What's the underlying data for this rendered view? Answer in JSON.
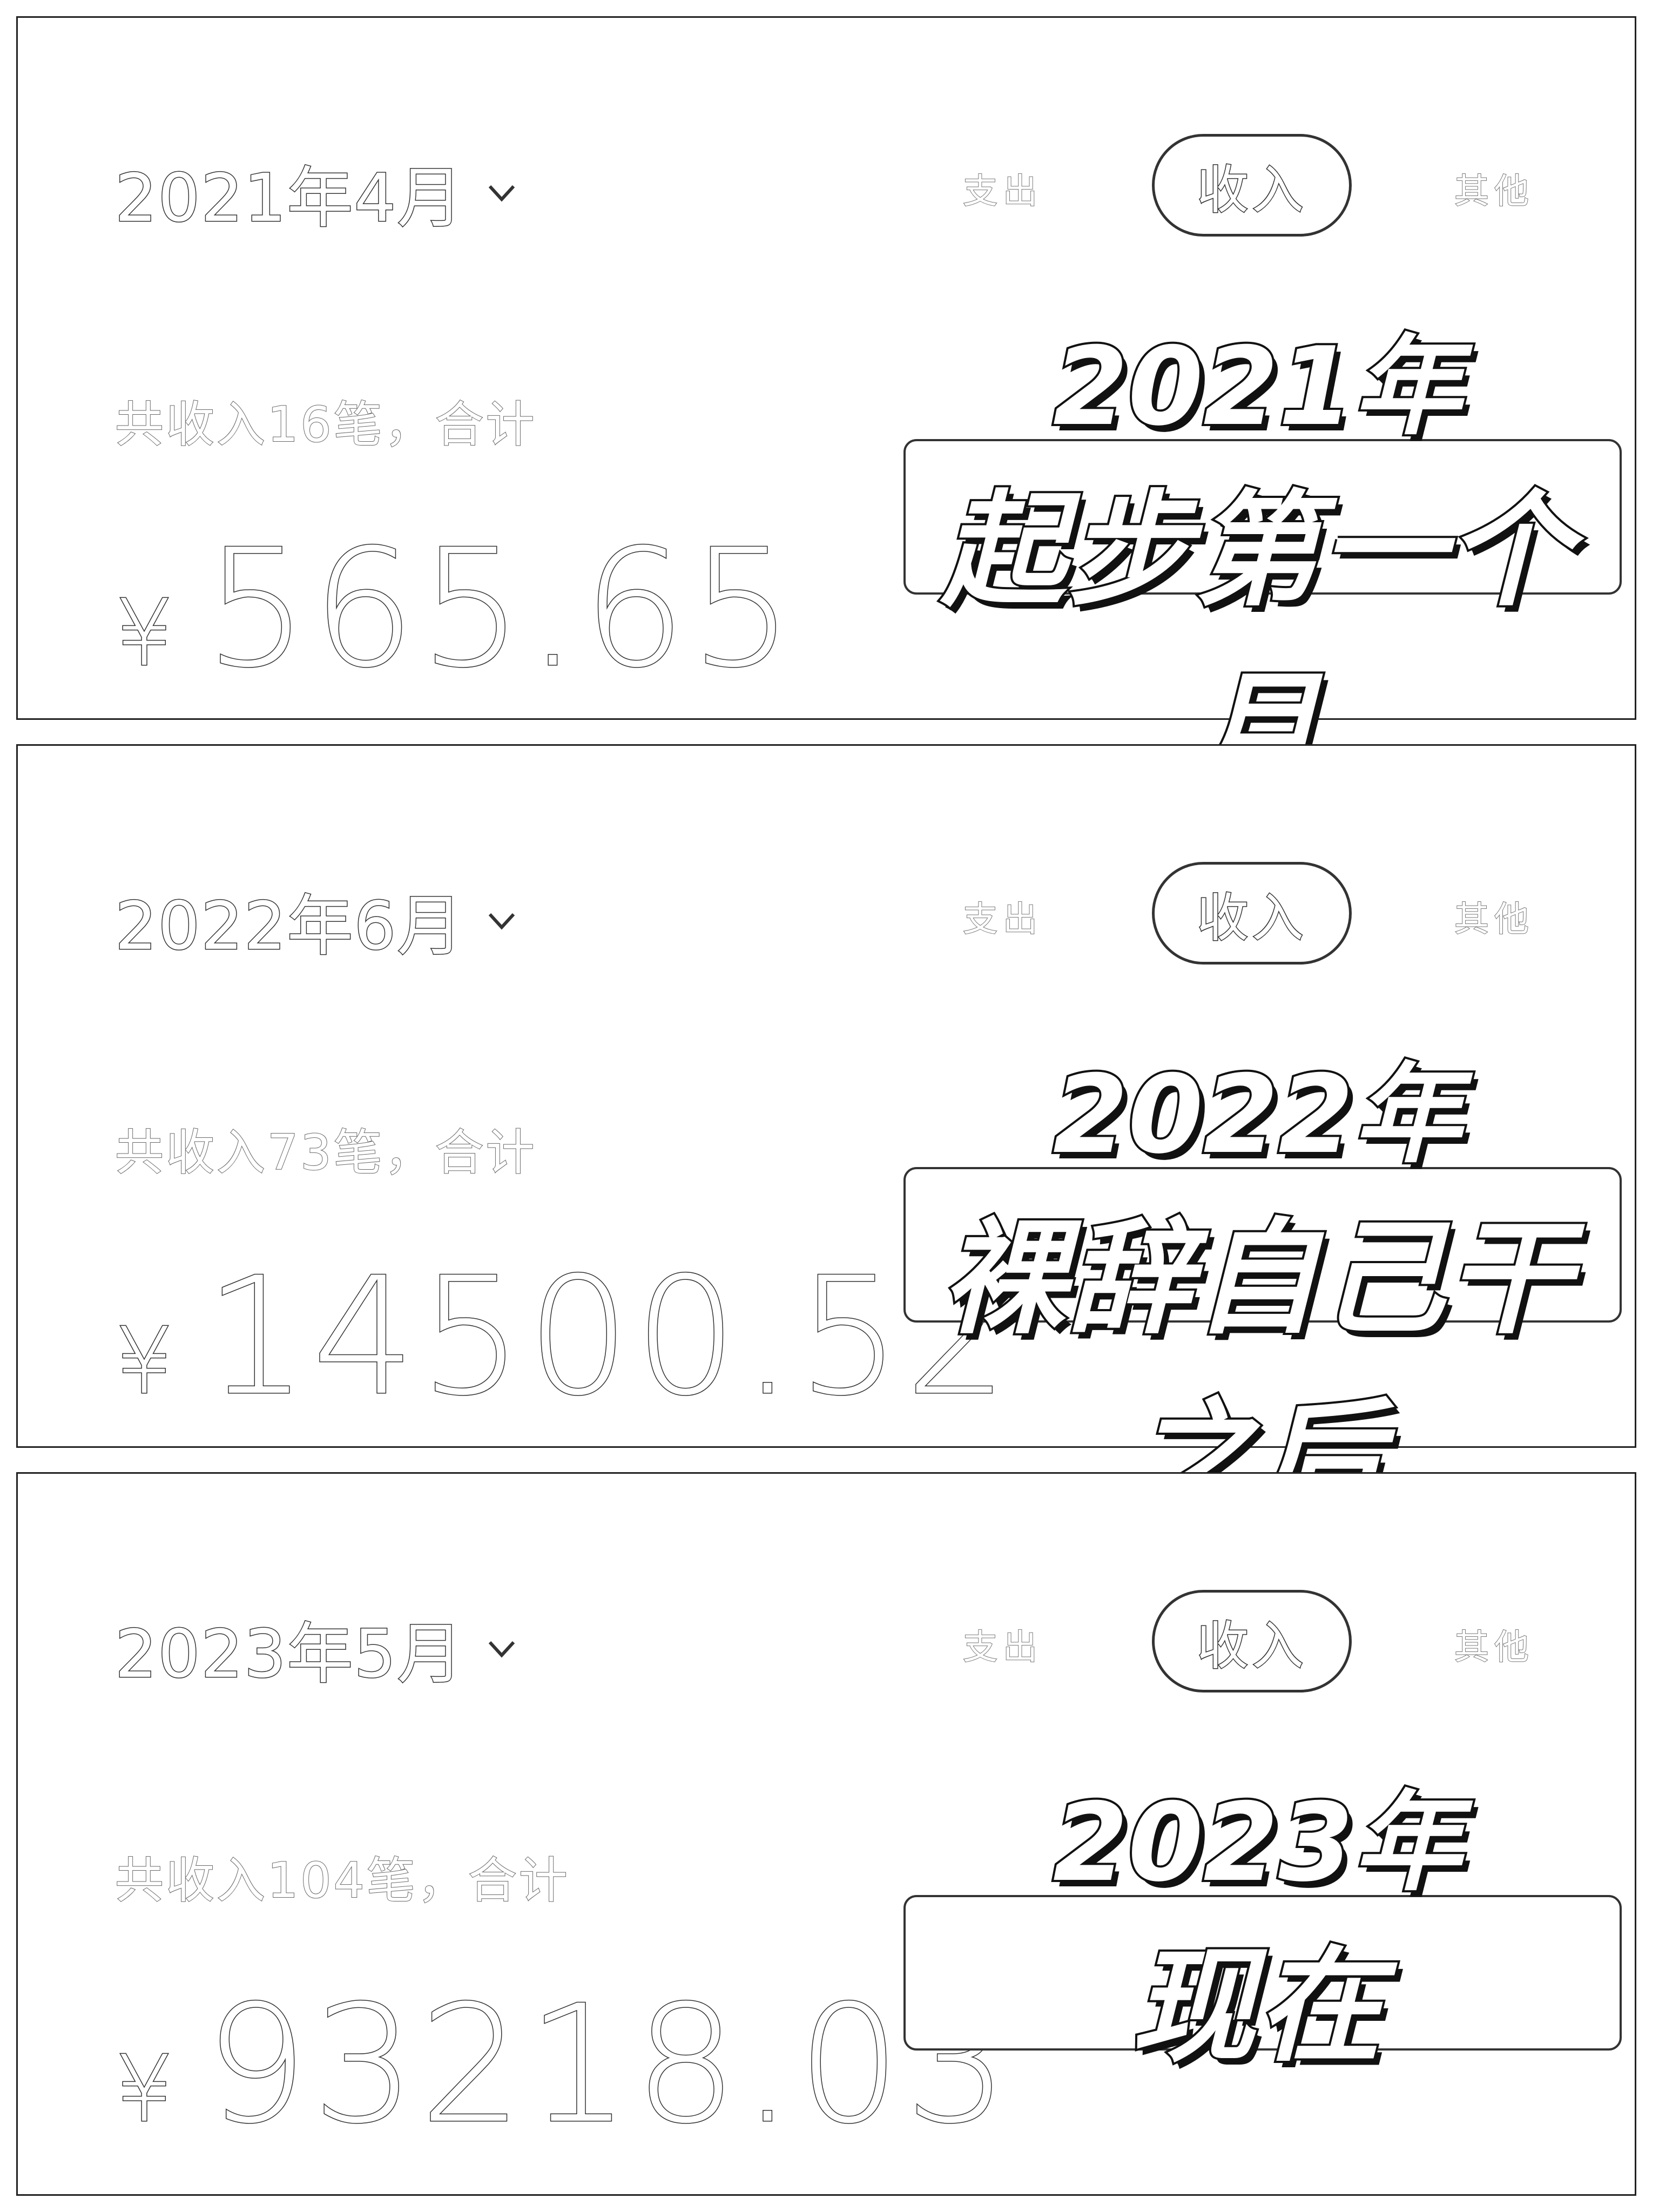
{
  "panels": [
    {
      "month_label": "2021年4月",
      "tabs": {
        "left": "支出",
        "active": "收入",
        "right": "其他"
      },
      "summary": "共收入16笔，合计",
      "currency": "¥",
      "amount": "565.65",
      "badge_year": "2021年",
      "badge_text": "起步第一个月"
    },
    {
      "month_label": "2022年6月",
      "tabs": {
        "left": "支出",
        "active": "收入",
        "right": "其他"
      },
      "summary": "共收入73笔，合计",
      "currency": "¥",
      "amount": "14500.52",
      "badge_year": "2022年",
      "badge_text": "裸辞自己干之后"
    },
    {
      "month_label": "2023年5月",
      "tabs": {
        "left": "支出",
        "active": "收入",
        "right": "其他"
      },
      "summary": "共收入104笔，合计",
      "currency": "¥",
      "amount": "93218.03",
      "badge_year": "2023年",
      "badge_text": "现在"
    }
  ],
  "icons": {
    "month_dropdown": "chevron-down-icon"
  }
}
